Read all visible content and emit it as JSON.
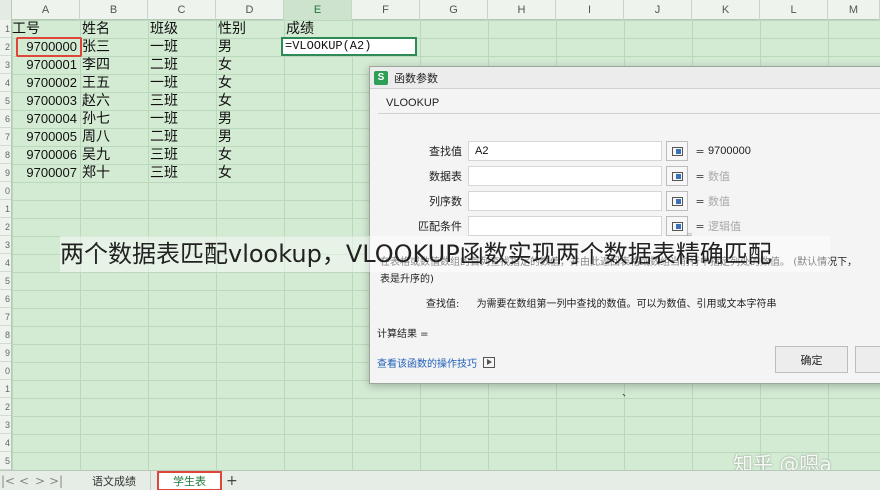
{
  "columns": [
    "A",
    "B",
    "C",
    "D",
    "E",
    "F",
    "G",
    "H",
    "I",
    "J",
    "K",
    "L",
    "M"
  ],
  "selected_column": "E",
  "row_numbers": [
    "1",
    "2",
    "3",
    "4",
    "5",
    "6",
    "7",
    "8",
    "9",
    "0",
    "1",
    "2",
    "3",
    "4",
    "5",
    "6",
    "7",
    "8",
    "9",
    "0",
    "1",
    "2",
    "3",
    "4",
    "5"
  ],
  "sheet_rows": [
    {
      "a": "工号",
      "b": "姓名",
      "c": "班级",
      "d": "性别",
      "e": "成绩"
    },
    {
      "a": "9700000",
      "b": "张三",
      "c": "一班",
      "d": "男",
      "e": ""
    },
    {
      "a": "9700001",
      "b": "李四",
      "c": "二班",
      "d": "女",
      "e": ""
    },
    {
      "a": "9700002",
      "b": "王五",
      "c": "一班",
      "d": "女",
      "e": ""
    },
    {
      "a": "9700003",
      "b": "赵六",
      "c": "三班",
      "d": "女",
      "e": ""
    },
    {
      "a": "9700004",
      "b": "孙七",
      "c": "一班",
      "d": "男",
      "e": ""
    },
    {
      "a": "9700005",
      "b": "周八",
      "c": "二班",
      "d": "男",
      "e": ""
    },
    {
      "a": "9700006",
      "b": "吴九",
      "c": "三班",
      "d": "女",
      "e": ""
    },
    {
      "a": "9700007",
      "b": "郑十",
      "c": "三班",
      "d": "女",
      "e": ""
    }
  ],
  "active_cell_formula": "=VLOOKUP(A2)",
  "dialog": {
    "title": "函数参数",
    "function_name": "VLOOKUP",
    "args": [
      {
        "label": "查找值",
        "input": "A2",
        "value": "9700000",
        "placeholder": false
      },
      {
        "label": "数据表",
        "input": "",
        "value": "数值",
        "placeholder": true
      },
      {
        "label": "列序数",
        "input": "",
        "value": "数值",
        "placeholder": true
      },
      {
        "label": "匹配条件",
        "input": "",
        "value": "逻辑值",
        "placeholder": true
      }
    ],
    "eq_sign": "=",
    "description_line1_start": "在表格或数值数组的首列查找指定的数值，并由此返回表格或数组当前行中指定列处的数值。",
    "description_line1_end": "(默认情况下，",
    "description_line2": "表是升序的)",
    "lookup_label": "查找值:",
    "lookup_desc": "为需要在数组第一列中查找的数值。可以为数值、引用或文本字符串",
    "calc_result": "计算结果 =",
    "help_link": "查看该函数的操作技巧",
    "ok_label": "确定"
  },
  "caption": "两个数据表匹配vlookup，VLOOKUP函数实现两个数据表精确匹配",
  "watermark": "知乎 @嗯a",
  "stray_mark": "、",
  "stray_mark2": "=",
  "tabs": {
    "nav_arrows": [
      "|<",
      "<",
      ">",
      ">|"
    ],
    "sheets": [
      "语文成绩",
      "学生表"
    ],
    "active_sheet": "学生表",
    "add": "+"
  },
  "colors": {
    "sheet_bg": "#d3ead3",
    "active_cell_border": "#2e8b57",
    "highlight_red": "#e0453a",
    "link_blue": "#1f5fb8"
  }
}
